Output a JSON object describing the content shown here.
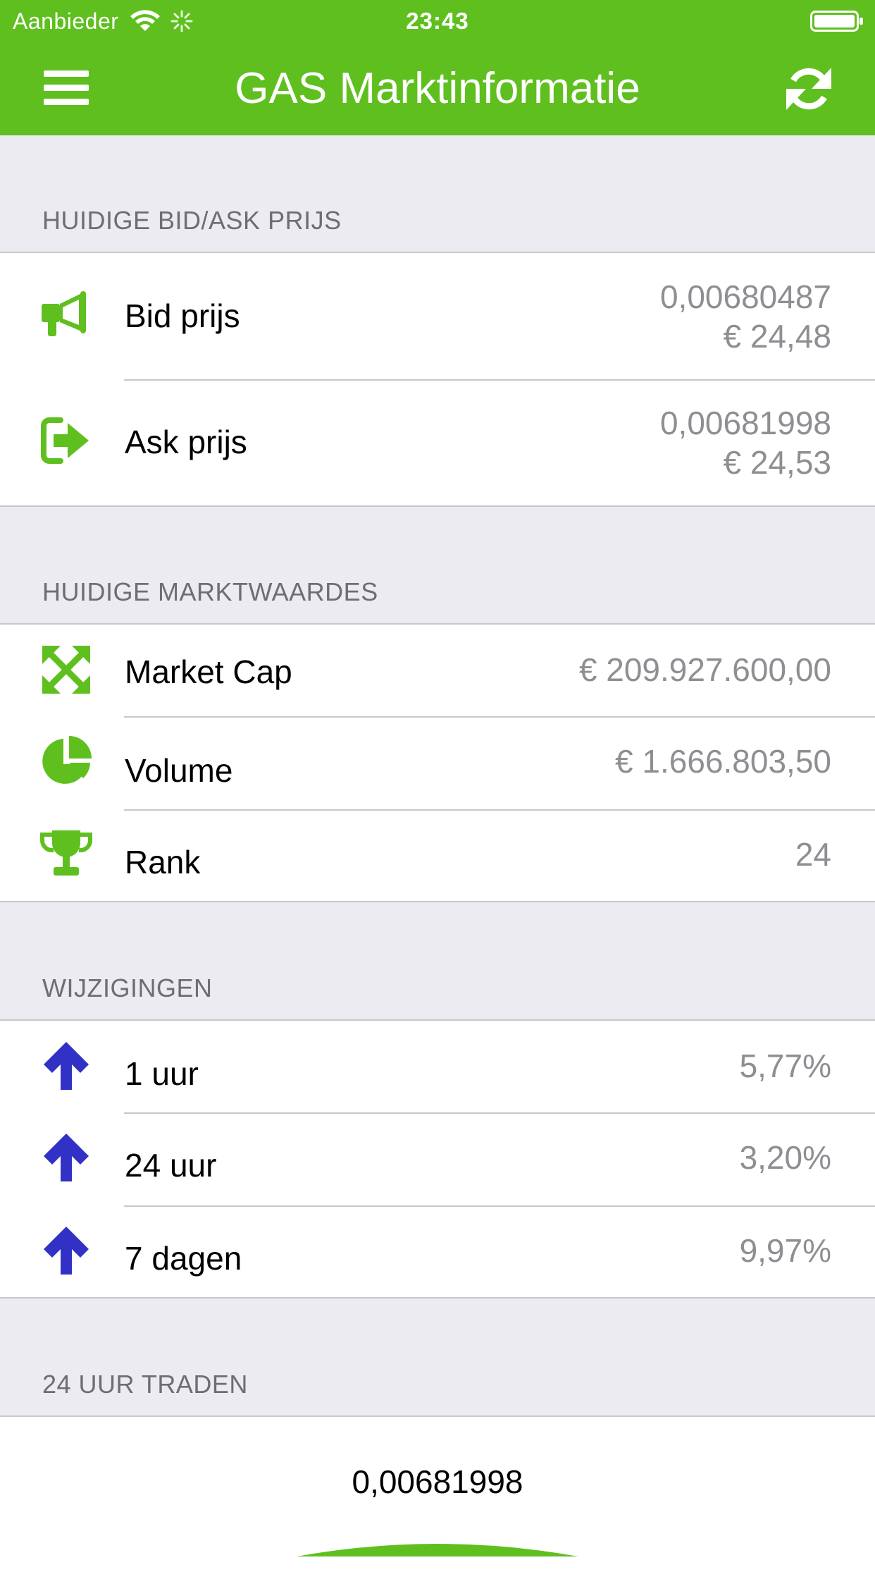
{
  "status_bar": {
    "carrier": "Aanbieder",
    "time": "23:43"
  },
  "nav": {
    "title": "GAS Marktinformatie"
  },
  "colors": {
    "brand": "#5fbf1f",
    "up_arrow": "#3231c6",
    "value_gray": "#8e8e93"
  },
  "sections": {
    "bidask": {
      "header": "HUIDIGE BID/ASK PRIJS",
      "rows": [
        {
          "icon": "megaphone-icon",
          "label": "Bid prijs",
          "value": "0,00680487",
          "value2": "€ 24,48"
        },
        {
          "icon": "sign-out-icon",
          "label": "Ask prijs",
          "value": "0,00681998",
          "value2": "€ 24,53"
        }
      ]
    },
    "market": {
      "header": "HUIDIGE MARKTWAARDES",
      "rows": [
        {
          "icon": "expand-arrows-icon",
          "label": "Market Cap",
          "value": "€ 209.927.600,00"
        },
        {
          "icon": "pie-chart-icon",
          "label": "Volume",
          "value": "€ 1.666.803,50"
        },
        {
          "icon": "trophy-icon",
          "label": "Rank",
          "value": "24"
        }
      ]
    },
    "changes": {
      "header": "WIJZIGINGEN",
      "rows": [
        {
          "icon": "arrow-up-icon",
          "label": "1 uur",
          "value": "5,77%"
        },
        {
          "icon": "arrow-up-icon",
          "label": "24 uur",
          "value": "3,20%"
        },
        {
          "icon": "arrow-up-icon",
          "label": "7 dagen",
          "value": "9,97%"
        }
      ]
    },
    "trading": {
      "header": "24 UUR TRADEN",
      "value": "0,00681998"
    }
  }
}
